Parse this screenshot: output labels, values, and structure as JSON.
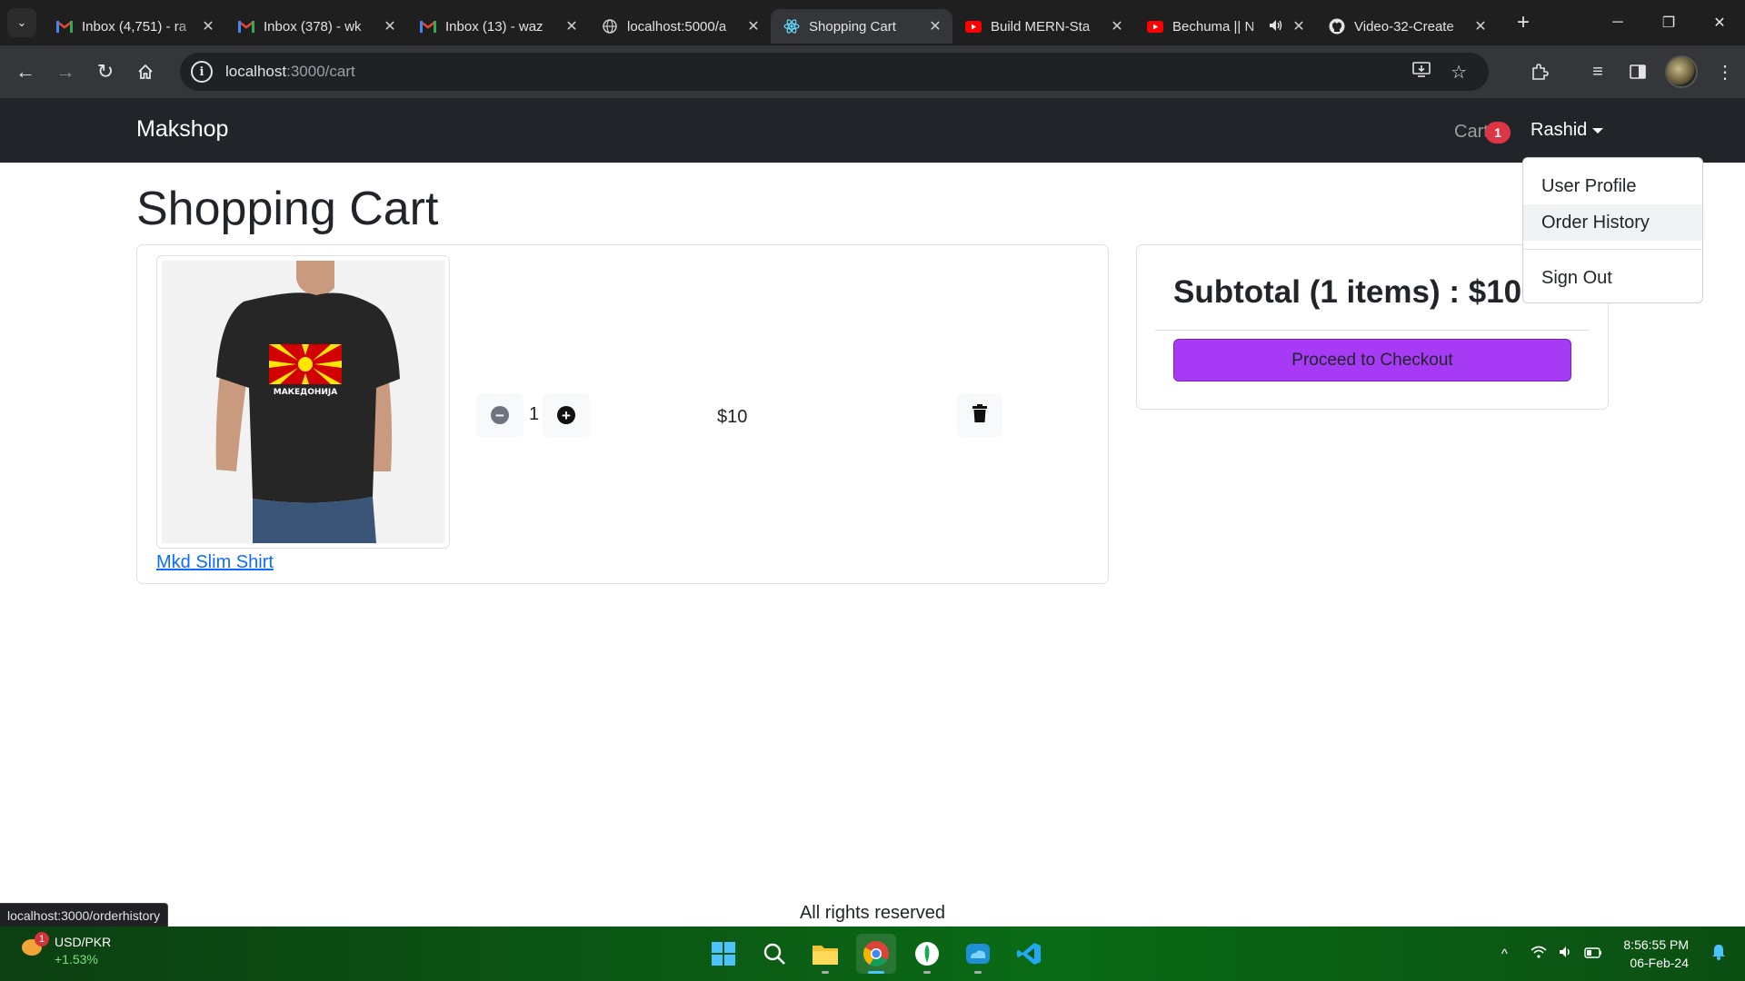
{
  "browser": {
    "tabs": [
      {
        "title": "Inbox (4,751) - ra",
        "icon": "gmail-icon"
      },
      {
        "title": "Inbox (378) - wk",
        "icon": "gmail-icon"
      },
      {
        "title": "Inbox (13) - waz",
        "icon": "gmail-icon"
      },
      {
        "title": "localhost:5000/a",
        "icon": "globe-icon"
      },
      {
        "title": "Shopping Cart",
        "icon": "react-icon",
        "active": true
      },
      {
        "title": "Build MERN-Sta",
        "icon": "youtube-icon"
      },
      {
        "title": "Bechuma || N",
        "icon": "youtube-icon",
        "audio": true
      },
      {
        "title": "Video-32-Create",
        "icon": "github-icon"
      }
    ],
    "url_host": "localhost",
    "url_rest": ":3000/cart",
    "status_url": "localhost:3000/orderhistory"
  },
  "navbar": {
    "brand": "Makshop",
    "cart_label": "Cart",
    "cart_count": "1",
    "user_name": "Rashid"
  },
  "dropdown": {
    "items": [
      "User Profile",
      "Order History",
      "Sign Out"
    ]
  },
  "page": {
    "title": "Shopping Cart"
  },
  "cart": {
    "items": [
      {
        "name": "Mkd Slim Shirt",
        "quantity": "1",
        "price": "$10",
        "shirt_print": "МАКЕДОНИЈА"
      }
    ]
  },
  "summary": {
    "subtotal": "Subtotal (1 items) : $10",
    "checkout_label": "Proceed to Checkout",
    "button_color": "#a63af5"
  },
  "footer": {
    "text": "All rights reserved"
  },
  "taskbar": {
    "weather_badge": "1",
    "ticker_symbol": "USD/PKR",
    "ticker_change": "+1.53%",
    "time": "8:56:55 PM",
    "date": "06-Feb-24"
  }
}
